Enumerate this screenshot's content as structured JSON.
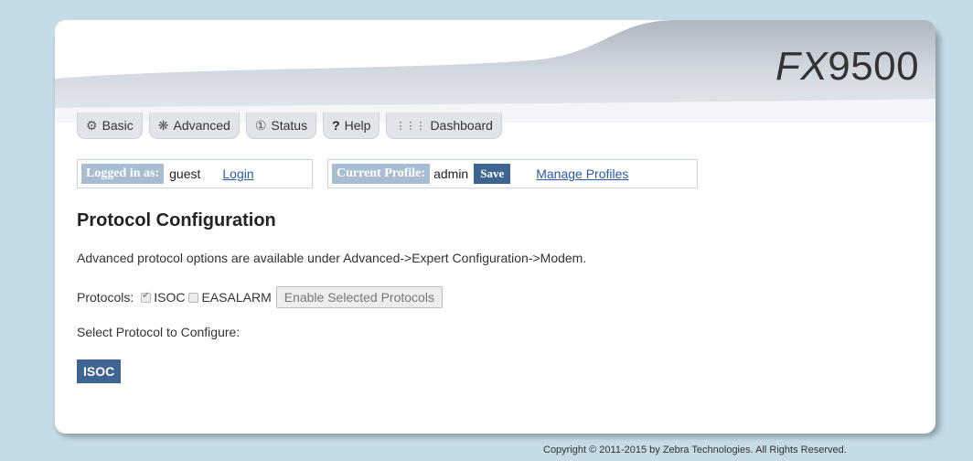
{
  "brand": {
    "logo_prefix": "FX",
    "logo_suffix": "9500"
  },
  "tabs": [
    {
      "label": "Basic",
      "icon": "gear-icon"
    },
    {
      "label": "Advanced",
      "icon": "gears-icon"
    },
    {
      "label": "Status",
      "icon": "info-circle-icon"
    },
    {
      "label": "Help",
      "icon": "question-icon"
    },
    {
      "label": "Dashboard",
      "icon": "grid-dots-icon"
    }
  ],
  "session": {
    "logged_in_label": "Logged in as:",
    "username": "guest",
    "login_link": "Login",
    "profile_label": "Current Profile:",
    "profile": "admin",
    "save_label": "Save",
    "manage_link": "Manage Profiles"
  },
  "page": {
    "title": "Protocol Configuration",
    "description": "Advanced protocol options are available under Advanced->Expert Configuration->Modem.",
    "protocols_label": "Protocols:",
    "protocols": [
      {
        "label": "ISOC",
        "checked": true
      },
      {
        "label": "EASALARM",
        "checked": false
      }
    ],
    "enable_button": "Enable Selected Protocols",
    "select_label": "Select Protocol to Configure:",
    "protocol_button": "ISOC"
  },
  "footer": {
    "copyright": "Copyright © 2011-2015 by Zebra Technologies. All Rights Reserved."
  },
  "colors": {
    "background": "#c5dbe6",
    "accent": "#3e6592",
    "label_bg": "#a9bdd2",
    "link": "#2c5aa8"
  }
}
